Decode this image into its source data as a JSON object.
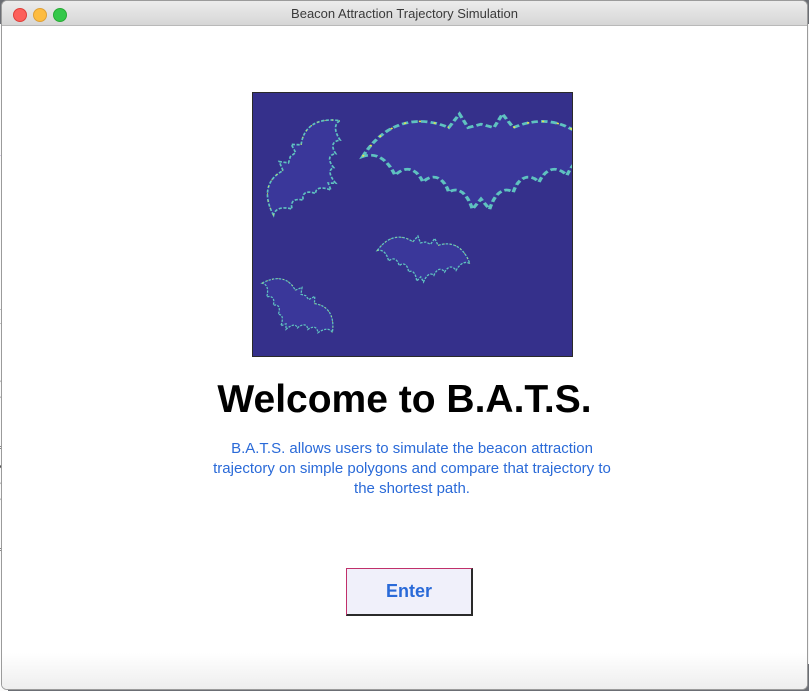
{
  "window": {
    "title": "Beacon Attraction Trajectory Simulation"
  },
  "main": {
    "image_alt": "bats-image",
    "heading": "Welcome to B.A.T.S.",
    "description": "B.A.T.S. allows users to simulate the beacon attraction trajectory on simple polygons and compare that trajectory to the shortest path.",
    "enter_label": "Enter"
  },
  "colors": {
    "image_background": "#35308b",
    "bat_outline": "#5fc2c0",
    "bat_fill": "#3a379a",
    "accent_text": "#2a6ad8",
    "button_border": "#c0306a"
  }
}
